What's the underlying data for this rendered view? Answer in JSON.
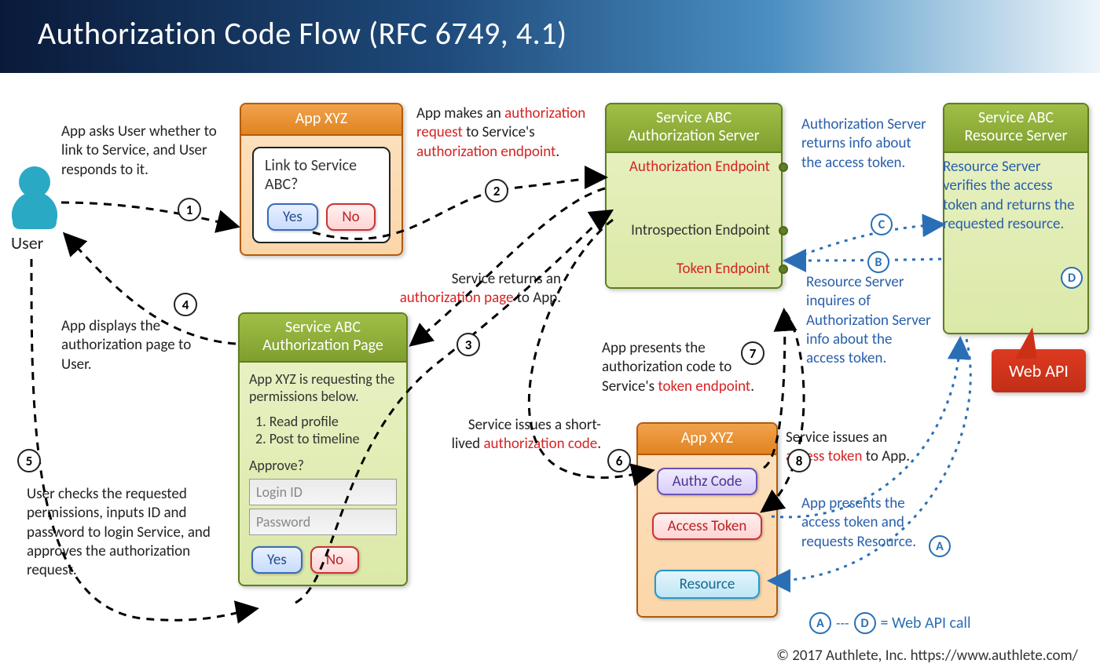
{
  "title": "Authorization Code Flow   (RFC 6749, 4.1)",
  "user_label": "User",
  "app1": {
    "title": "App XYZ",
    "prompt": "Link to Service ABC?",
    "yes": "Yes",
    "no": "No"
  },
  "authz_page": {
    "title": "Service ABC Authorization Page",
    "request_text": "App XYZ is requesting the permissions below.",
    "perm1": "1. Read profile",
    "perm2": "2. Post to timeline",
    "approve_label": "Approve?",
    "login_ph": "Login ID",
    "password_ph": "Password",
    "yes": "Yes",
    "no": "No"
  },
  "auth_server": {
    "title": "Service ABC Authorization Server",
    "ep_authorize": "Authorization Endpoint",
    "ep_introspect": "Introspection Endpoint",
    "ep_token": "Token Endpoint"
  },
  "app2": {
    "title": "App XYZ",
    "authz_code": "Authz Code",
    "access_token": "Access Token",
    "resource": "Resource"
  },
  "resource_server_title": "Service ABC Resource Server",
  "notes": {
    "n1": "App asks User whether to link to Service, and User responds to it.",
    "n2a": "App makes an ",
    "n2b": "authorization request",
    "n2c": " to Service's ",
    "n2d": "authorization endpoint",
    "n2e": ".",
    "n3a": "Service returns an ",
    "n3b": "authorization page",
    "n3c": " to App.",
    "n4": "App displays the authorization page to User.",
    "n5": "User checks the requested permissions, inputs ID and password to login Service, and approves the authorization request.",
    "n6a": "Service issues a short-lived ",
    "n6b": "authorization code",
    "n6c": ".",
    "n7a": "App presents the authorization code to Service's ",
    "n7b": "token endpoint",
    "n7c": ".",
    "n8a": "Service issues an ",
    "n8b": "access token",
    "n8c": " to App.",
    "nA": "App presents the access token and requests Resource.",
    "nB": "Resource Server inquires of Authorization Server info about the access token.",
    "nC": "Authorization Server returns info about the access token.",
    "nD": "Resource Server verifies the access token and returns the requested resource."
  },
  "webapi_label": "Web API",
  "legend_equals": " = Web API call",
  "footer": "© 2017 Authlete, Inc.  https://www.authlete.com/"
}
